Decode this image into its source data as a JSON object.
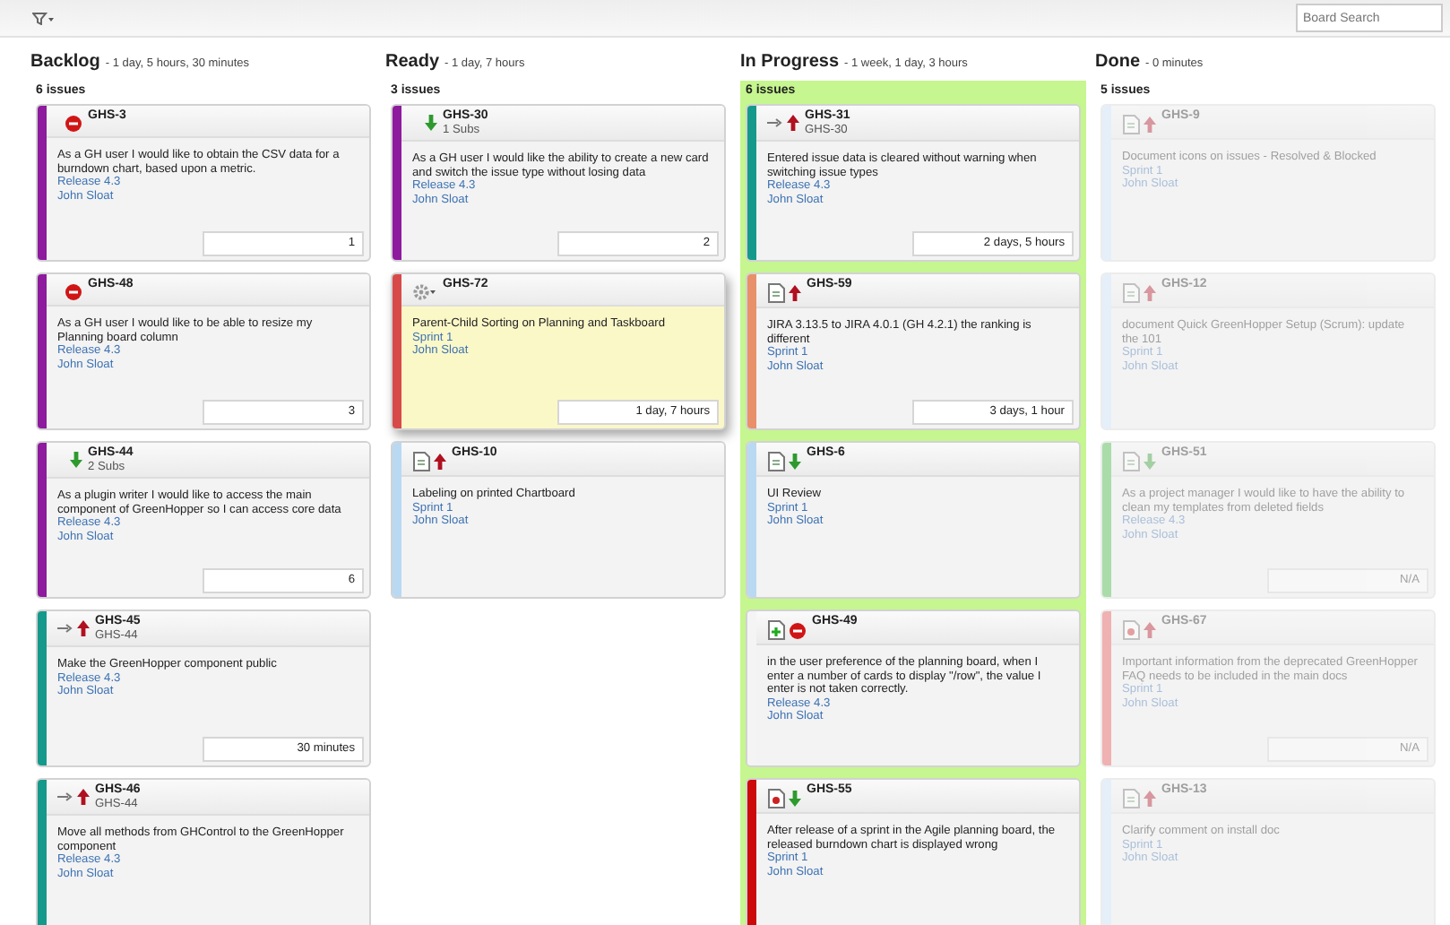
{
  "toolbar": {
    "search": {
      "placeholder": "Board Search"
    }
  },
  "columns": [
    {
      "name": "Backlog",
      "duration": "- 1 day, 5 hours, 30 minutes",
      "count": "6 issues",
      "highlighted": false,
      "cards": [
        {
          "key": "GHS-3",
          "icons": [
            {
              "kind": "blocker"
            }
          ],
          "color": "#8e1a9e",
          "summary": "As a GH user I would like to obtain the CSV data for a burndown chart, based upon a metric.",
          "version": "Release 4.3",
          "assignee": "John Sloat",
          "estimate": "1",
          "resolved": false,
          "dragged": false
        },
        {
          "key": "GHS-48",
          "icons": [
            {
              "kind": "blocker"
            }
          ],
          "color": "#8e1a9e",
          "summary": "As a GH user I would like to be able to resize my Planning board column",
          "version": "Release 4.3",
          "assignee": "John Sloat",
          "estimate": "3",
          "resolved": false,
          "dragged": false
        },
        {
          "key": "GHS-44",
          "sub": "2 Subs",
          "icons": [
            {
              "kind": "minor"
            }
          ],
          "color": "#8e1a9e",
          "summary": "As a plugin writer I would like to access the main component of GreenHopper so I can access core data",
          "version": "Release 4.3",
          "assignee": "John Sloat",
          "estimate": "6",
          "resolved": false,
          "dragged": false
        },
        {
          "key": "GHS-45",
          "sub": "GHS-44",
          "icons": [
            {
              "kind": "subtask"
            },
            {
              "kind": "major"
            }
          ],
          "color": "#15998a",
          "summary": "Make the GreenHopper component public",
          "version": "Release 4.3",
          "assignee": "John Sloat",
          "estimate": "30 minutes",
          "resolved": false,
          "dragged": false
        },
        {
          "key": "GHS-46",
          "sub": "GHS-44",
          "icons": [
            {
              "kind": "subtask"
            },
            {
              "kind": "major"
            }
          ],
          "color": "#15998a",
          "summary": "Move all methods from GHControl to the GreenHopper component",
          "version": "Release 4.3",
          "assignee": "John Sloat",
          "resolved": false,
          "dragged": false
        }
      ]
    },
    {
      "name": "Ready",
      "duration": "- 1 day, 7 hours",
      "count": "3 issues",
      "highlighted": false,
      "cards": [
        {
          "key": "GHS-30",
          "sub": "1 Subs",
          "icons": [
            {
              "kind": "minor"
            }
          ],
          "color": "#8e1a9e",
          "summary": "As a GH user I would like the ability to create a new card and switch the issue type without losing data",
          "version": "Release 4.3",
          "assignee": "John Sloat",
          "estimate": "2",
          "resolved": false,
          "dragged": false
        },
        {
          "key": "GHS-72",
          "icons": [
            {
              "kind": "gear"
            }
          ],
          "color": "#d84a4a",
          "summary": "Parent-Child Sorting on Planning and Taskboard",
          "version": "Sprint 1",
          "assignee": "John Sloat",
          "estimate": "1 day, 7 hours",
          "resolved": false,
          "dragged": true
        },
        {
          "key": "GHS-10",
          "icons": [
            {
              "kind": "task"
            },
            {
              "kind": "major"
            }
          ],
          "color": "#b9d9f2",
          "summary": "Labeling on printed Chartboard",
          "version": "Sprint 1",
          "assignee": "John Sloat",
          "resolved": false,
          "dragged": false
        }
      ]
    },
    {
      "name": "In Progress",
      "duration": "- 1 week, 1 day, 3 hours",
      "count": "6 issues",
      "highlighted": true,
      "cards": [
        {
          "key": "GHS-31",
          "sub": "GHS-30",
          "icons": [
            {
              "kind": "subtask"
            },
            {
              "kind": "major"
            }
          ],
          "color": "#15998a",
          "summary": "Entered issue data is cleared without warning when switching issue types",
          "version": "Release 4.3",
          "assignee": "John Sloat",
          "estimate": "2 days, 5 hours",
          "resolved": false,
          "dragged": false
        },
        {
          "key": "GHS-59",
          "icons": [
            {
              "kind": "task"
            },
            {
              "kind": "major"
            }
          ],
          "color": "#e8906a",
          "summary": "JIRA 3.13.5 to JIRA 4.0.1 (GH 4.2.1) the ranking is different",
          "version": "Sprint 1",
          "assignee": "John Sloat",
          "estimate": "3 days, 1 hour",
          "resolved": false,
          "dragged": false
        },
        {
          "key": "GHS-6",
          "icons": [
            {
              "kind": "task"
            },
            {
              "kind": "minor"
            }
          ],
          "color": "#b9d9f2",
          "summary": "UI Review",
          "version": "Sprint 1",
          "assignee": "John Sloat",
          "resolved": false,
          "dragged": false
        },
        {
          "key": "GHS-49",
          "icons": [
            {
              "kind": "improvement"
            },
            {
              "kind": "blocker"
            }
          ],
          "color": "#f4f4f4",
          "summary": "in the user preference of the planning board, when I enter a number of cards to display \"/row\", the value I enter is not taken correctly.",
          "version": "Release 4.3",
          "assignee": "John Sloat",
          "resolved": false,
          "dragged": false
        },
        {
          "key": "GHS-55",
          "icons": [
            {
              "kind": "bug"
            },
            {
              "kind": "minor"
            }
          ],
          "color": "#cc0a0a",
          "summary": "After release of a sprint in the Agile planning board, the released burndown chart is displayed wrong",
          "version": "Sprint 1",
          "assignee": "John Sloat",
          "resolved": false,
          "dragged": false
        }
      ]
    },
    {
      "name": "Done",
      "duration": "- 0 minutes",
      "count": "5 issues",
      "highlighted": false,
      "cards": [
        {
          "key": "GHS-9",
          "icons": [
            {
              "kind": "task"
            },
            {
              "kind": "major"
            }
          ],
          "color": "#e4eff9",
          "summary": "Document icons on issues - Resolved & Blocked",
          "version": "Sprint 1",
          "assignee": "John Sloat",
          "resolved": true,
          "dragged": false
        },
        {
          "key": "GHS-12",
          "icons": [
            {
              "kind": "task"
            },
            {
              "kind": "major"
            }
          ],
          "color": "#e4eff9",
          "summary": "document Quick GreenHopper Setup (Scrum): update the 101",
          "version": "Sprint 1",
          "assignee": "John Sloat",
          "resolved": true,
          "dragged": false
        },
        {
          "key": "GHS-51",
          "icons": [
            {
              "kind": "task"
            },
            {
              "kind": "minor"
            }
          ],
          "color": "#a9dca9",
          "summary": "As a project manager I would like to have the ability to clean my templates from deleted fields",
          "version": "Release 4.3",
          "assignee": "John Sloat",
          "estimate": "N/A",
          "resolved": true,
          "dragged": false
        },
        {
          "key": "GHS-67",
          "icons": [
            {
              "kind": "bug"
            },
            {
              "kind": "major"
            }
          ],
          "color": "#efb1b1",
          "summary": "Important information from the deprecated GreenHopper FAQ needs to be included in the main docs",
          "version": "Sprint 1",
          "assignee": "John Sloat",
          "estimate": "N/A",
          "resolved": true,
          "dragged": false
        },
        {
          "key": "GHS-13",
          "icons": [
            {
              "kind": "task"
            },
            {
              "kind": "major"
            }
          ],
          "color": "#e4eff9",
          "summary": "Clarify comment on install doc",
          "version": "Sprint 1",
          "assignee": "John Sloat",
          "resolved": true,
          "dragged": false
        }
      ]
    }
  ]
}
